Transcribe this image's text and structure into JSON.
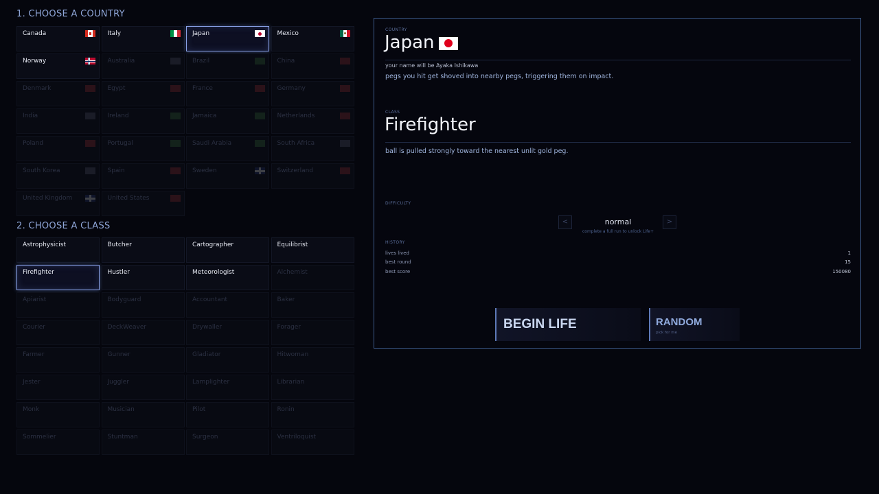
{
  "country_section": {
    "title": "1.  CHOOSE A COUNTRY"
  },
  "countries": [
    {
      "name": "Canada",
      "flag": "canada",
      "locked": false,
      "selected": false
    },
    {
      "name": "Italy",
      "flag": "italy",
      "locked": false,
      "selected": false
    },
    {
      "name": "Japan",
      "flag": "japan",
      "locked": false,
      "selected": true
    },
    {
      "name": "Mexico",
      "flag": "mexico",
      "locked": false,
      "selected": false
    },
    {
      "name": "Norway",
      "flag": "norway",
      "locked": false,
      "selected": false
    },
    {
      "name": "Australia",
      "flag": "grey",
      "locked": true,
      "selected": false
    },
    {
      "name": "Brazil",
      "flag": "green",
      "locked": true,
      "selected": false
    },
    {
      "name": "China",
      "flag": "red",
      "locked": true,
      "selected": false
    },
    {
      "name": "Denmark",
      "flag": "red",
      "locked": true,
      "selected": false
    },
    {
      "name": "Egypt",
      "flag": "red",
      "locked": true,
      "selected": false
    },
    {
      "name": "France",
      "flag": "red",
      "locked": true,
      "selected": false
    },
    {
      "name": "Germany",
      "flag": "red",
      "locked": true,
      "selected": false
    },
    {
      "name": "India",
      "flag": "grey",
      "locked": true,
      "selected": false
    },
    {
      "name": "Ireland",
      "flag": "green",
      "locked": true,
      "selected": false
    },
    {
      "name": "Jamaica",
      "flag": "green",
      "locked": true,
      "selected": false
    },
    {
      "name": "Netherlands",
      "flag": "red",
      "locked": true,
      "selected": false
    },
    {
      "name": "Poland",
      "flag": "red",
      "locked": true,
      "selected": false
    },
    {
      "name": "Portugal",
      "flag": "green",
      "locked": true,
      "selected": false
    },
    {
      "name": "Saudi Arabia",
      "flag": "green",
      "locked": true,
      "selected": false
    },
    {
      "name": "South Africa",
      "flag": "grey",
      "locked": true,
      "selected": false
    },
    {
      "name": "South Korea",
      "flag": "grey",
      "locked": true,
      "selected": false
    },
    {
      "name": "Spain",
      "flag": "red",
      "locked": true,
      "selected": false
    },
    {
      "name": "Sweden",
      "flag": "uk",
      "locked": true,
      "selected": false
    },
    {
      "name": "Switzerland",
      "flag": "red",
      "locked": true,
      "selected": false
    },
    {
      "name": "United Kingdom",
      "flag": "uk",
      "locked": true,
      "selected": false
    },
    {
      "name": "United States",
      "flag": "red",
      "locked": true,
      "selected": false
    }
  ],
  "class_section": {
    "title": "2.  CHOOSE A CLASS"
  },
  "classes": [
    {
      "name": "Astrophysicist",
      "locked": false,
      "selected": false
    },
    {
      "name": "Butcher",
      "locked": false,
      "selected": false
    },
    {
      "name": "Cartographer",
      "locked": false,
      "selected": false
    },
    {
      "name": "Equilibrist",
      "locked": false,
      "selected": false
    },
    {
      "name": "Firefighter",
      "locked": false,
      "selected": true
    },
    {
      "name": "Hustler",
      "locked": false,
      "selected": false
    },
    {
      "name": "Meteorologist",
      "locked": false,
      "selected": false
    },
    {
      "name": "Alchemist",
      "locked": true,
      "selected": false
    },
    {
      "name": "Apiarist",
      "locked": true,
      "selected": false
    },
    {
      "name": "Bodyguard",
      "locked": true,
      "selected": false
    },
    {
      "name": "Accountant",
      "locked": true,
      "selected": false
    },
    {
      "name": "Baker",
      "locked": true,
      "selected": false
    },
    {
      "name": "Courier",
      "locked": true,
      "selected": false
    },
    {
      "name": "DeckWeaver",
      "locked": true,
      "selected": false
    },
    {
      "name": "Drywaller",
      "locked": true,
      "selected": false
    },
    {
      "name": "Forager",
      "locked": true,
      "selected": false
    },
    {
      "name": "Farmer",
      "locked": true,
      "selected": false
    },
    {
      "name": "Gunner",
      "locked": true,
      "selected": false
    },
    {
      "name": "Gladiator",
      "locked": true,
      "selected": false
    },
    {
      "name": "Hitwoman",
      "locked": true,
      "selected": false
    },
    {
      "name": "Jester",
      "locked": true,
      "selected": false
    },
    {
      "name": "Juggler",
      "locked": true,
      "selected": false
    },
    {
      "name": "Lamplighter",
      "locked": true,
      "selected": false
    },
    {
      "name": "Librarian",
      "locked": true,
      "selected": false
    },
    {
      "name": "Monk",
      "locked": true,
      "selected": false
    },
    {
      "name": "Musician",
      "locked": true,
      "selected": false
    },
    {
      "name": "Pilot",
      "locked": true,
      "selected": false
    },
    {
      "name": "Ronin",
      "locked": true,
      "selected": false
    },
    {
      "name": "Sommelier",
      "locked": true,
      "selected": false
    },
    {
      "name": "Stuntman",
      "locked": true,
      "selected": false
    },
    {
      "name": "Surgeon",
      "locked": true,
      "selected": false
    },
    {
      "name": "Ventriloquist",
      "locked": true,
      "selected": false
    }
  ],
  "panel": {
    "country_label": "COUNTRY",
    "country_name": "Japan",
    "name_line": "your name will be Ayaka Ishikawa",
    "country_desc": "pegs you hit get shoved into nearby pegs, triggering them on impact.",
    "class_label": "CLASS",
    "class_name": "Firefighter",
    "class_desc": "ball is pulled strongly toward the nearest unlit gold peg.",
    "difficulty_label": "DIFFICULTY",
    "difficulty_prev": "<",
    "difficulty_value": "normal",
    "difficulty_next": ">",
    "difficulty_note": "complete a full run to unlock Life+",
    "history_label": "HISTORY",
    "history": [
      {
        "label": "lives lived",
        "value": "1"
      },
      {
        "label": "best round",
        "value": "15"
      },
      {
        "label": "best score",
        "value": "150080"
      }
    ],
    "begin_label": "BEGIN LIFE",
    "random_label": "RANDOM",
    "random_sub": "pick for me"
  },
  "colors": {
    "background": "#05060d",
    "accent": "#8aa2e8",
    "panel_border": "#3d5b8c"
  }
}
